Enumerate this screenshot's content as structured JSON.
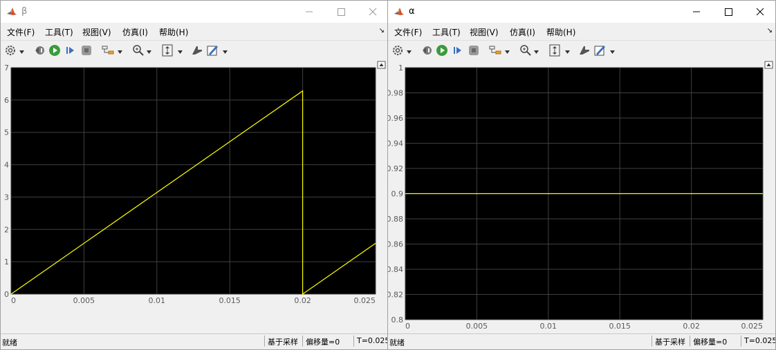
{
  "windows": [
    {
      "id": "beta",
      "title": "β",
      "menu": [
        "文件(F)",
        "工具(T)",
        "视图(V)",
        "仿真(I)",
        "帮助(H)"
      ],
      "status": {
        "ready": "就绪",
        "sampling": "基于采样",
        "offset": "偏移量=0",
        "time": "T=0.025"
      },
      "chart_data": {
        "type": "line",
        "xlim": [
          0,
          0.025
        ],
        "ylim": [
          0,
          7
        ],
        "xticks": [
          "0",
          "0.005",
          "0.01",
          "0.015",
          "0.02",
          "0.025"
        ],
        "yticks": [
          "0",
          "1",
          "2",
          "3",
          "4",
          "5",
          "6",
          "7"
        ],
        "grid": true,
        "series": [
          {
            "color": "#ffff00",
            "x": [
              0,
              0.02,
              0.02,
              0.025
            ],
            "y": [
              0,
              6.28,
              0,
              1.57
            ]
          }
        ]
      }
    },
    {
      "id": "alpha",
      "title": "α",
      "menu": [
        "文件(F)",
        "工具(T)",
        "视图(V)",
        "仿真(I)",
        "帮助(H)"
      ],
      "status": {
        "ready": "就绪",
        "sampling": "基于采样",
        "offset": "偏移量=0",
        "time": "T=0.025"
      },
      "chart_data": {
        "type": "line",
        "xlim": [
          0,
          0.025
        ],
        "ylim": [
          0.8,
          1
        ],
        "xticks": [
          "0",
          "0.005",
          "0.01",
          "0.015",
          "0.02",
          "0.025"
        ],
        "yticks": [
          "0.8",
          "0.82",
          "0.84",
          "0.86",
          "0.88",
          "0.9",
          "0.92",
          "0.94",
          "0.96",
          "0.98",
          "1"
        ],
        "grid": true,
        "series": [
          {
            "color": "#ffff00",
            "x": [
              0,
              0.025
            ],
            "y": [
              0.9,
              0.9
            ]
          }
        ]
      }
    }
  ],
  "icons": {
    "app": "matlab-logo-icon",
    "toolbar": [
      "settings-icon",
      "step-back-icon",
      "run-icon",
      "step-forward-icon",
      "stop-icon",
      "signal-selector-icon",
      "zoom-icon",
      "scale-axes-icon",
      "cursor-measure-icon",
      "style-icon"
    ]
  },
  "colors": {
    "plot_bg": "#000000",
    "grid": "#404040",
    "trace": "#ffff00",
    "axis_label": "#5a5a5a"
  }
}
